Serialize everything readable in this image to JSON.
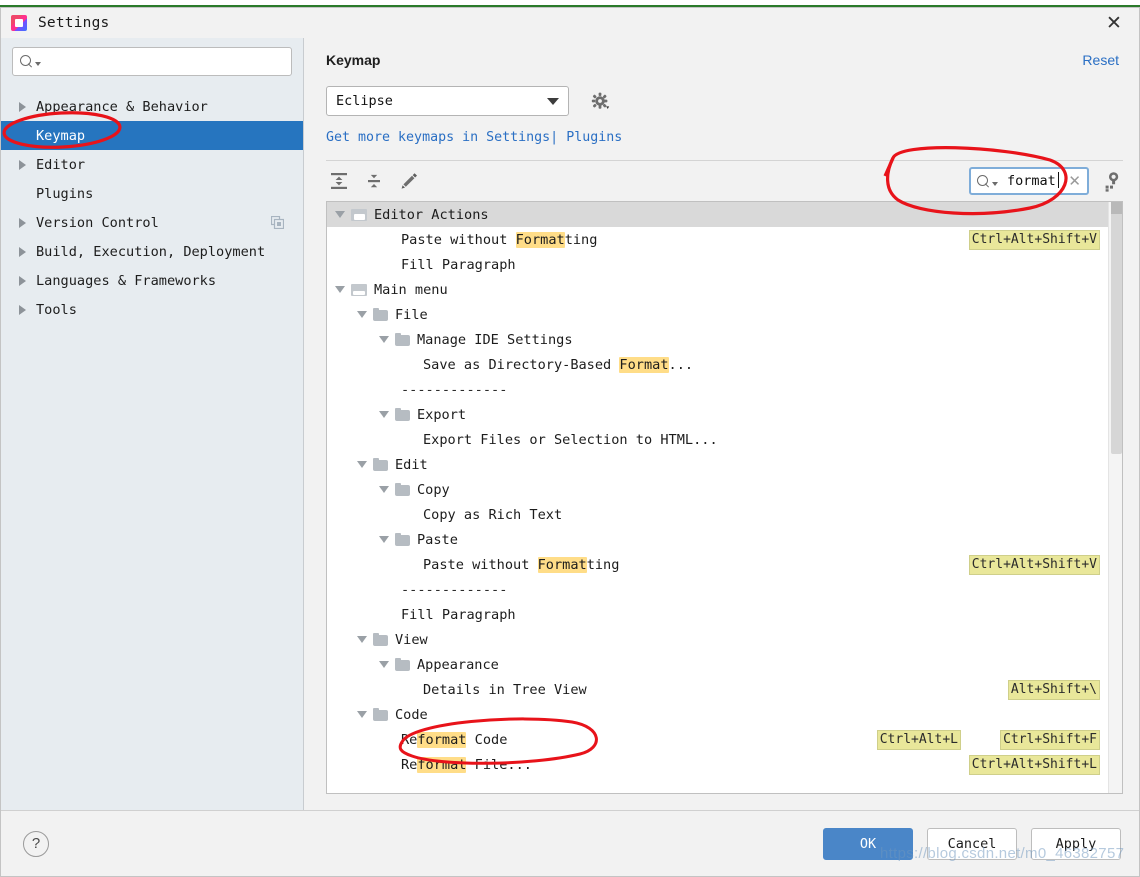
{
  "window": {
    "title": "Settings",
    "app_icon": "intellij-icon",
    "close_label": "✕"
  },
  "sidebar": {
    "search_placeholder": "",
    "search_value": "",
    "items": [
      {
        "label": "Appearance & Behavior",
        "expandable": true,
        "selected": false
      },
      {
        "label": "Keymap",
        "expandable": false,
        "selected": true
      },
      {
        "label": "Editor",
        "expandable": true,
        "selected": false
      },
      {
        "label": "Plugins",
        "expandable": false,
        "selected": false
      },
      {
        "label": "Version Control",
        "expandable": true,
        "selected": false,
        "badge_icon": "copy-icon"
      },
      {
        "label": "Build, Execution, Deployment",
        "expandable": true,
        "selected": false
      },
      {
        "label": "Languages & Frameworks",
        "expandable": true,
        "selected": false
      },
      {
        "label": "Tools",
        "expandable": true,
        "selected": false
      }
    ]
  },
  "content": {
    "title": "Keymap",
    "reset_label": "Reset",
    "keymap_select_value": "Eclipse",
    "gear_icon": "gear-icon",
    "links": {
      "prefix": "Get more keymaps in Settings",
      "separator": "|",
      "plugins": "Plugins"
    },
    "toolbar": {
      "expand_all_icon": "expand-all-icon",
      "collapse_all_icon": "collapse-all-icon",
      "edit_icon": "pencil-edit-icon"
    },
    "search": {
      "value": "format",
      "clear_label": "✕",
      "filter_icon": "filter-by-shortcut-icon"
    }
  },
  "tree": {
    "rows": [
      {
        "indent": 0,
        "twisty": "down",
        "icon": "editor-actions-icon",
        "text": "Editor Actions",
        "highlight": null,
        "shortcut": null,
        "header": true
      },
      {
        "indent": 3,
        "twisty": null,
        "icon": null,
        "text": "Paste without Formatting",
        "highlight": "Format",
        "shortcut": "Ctrl+Alt+Shift+V",
        "header": false
      },
      {
        "indent": 3,
        "twisty": null,
        "icon": null,
        "text": "Fill Paragraph",
        "highlight": null,
        "shortcut": null,
        "header": false
      },
      {
        "indent": 0,
        "twisty": "down",
        "icon": "main-menu-icon",
        "text": "Main menu",
        "highlight": null,
        "shortcut": null,
        "header": false
      },
      {
        "indent": 1,
        "twisty": "down",
        "icon": "folder-icon",
        "text": "File",
        "highlight": null,
        "shortcut": null,
        "header": false
      },
      {
        "indent": 2,
        "twisty": "down",
        "icon": "folder-icon",
        "text": "Manage IDE Settings",
        "highlight": null,
        "shortcut": null,
        "header": false
      },
      {
        "indent": 4,
        "twisty": null,
        "icon": null,
        "text": "Save as Directory-Based Format...",
        "highlight": "Format",
        "shortcut": null,
        "header": false
      },
      {
        "indent": 3,
        "twisty": null,
        "icon": null,
        "text": "-------------",
        "highlight": null,
        "shortcut": null,
        "header": false,
        "separator": true
      },
      {
        "indent": 2,
        "twisty": "down",
        "icon": "folder-icon",
        "text": "Export",
        "highlight": null,
        "shortcut": null,
        "header": false
      },
      {
        "indent": 4,
        "twisty": null,
        "icon": null,
        "text": "Export Files or Selection to HTML...",
        "highlight": null,
        "shortcut": null,
        "header": false
      },
      {
        "indent": 1,
        "twisty": "down",
        "icon": "folder-icon",
        "text": "Edit",
        "highlight": null,
        "shortcut": null,
        "header": false
      },
      {
        "indent": 2,
        "twisty": "down",
        "icon": "folder-icon",
        "text": "Copy",
        "highlight": null,
        "shortcut": null,
        "header": false
      },
      {
        "indent": 4,
        "twisty": null,
        "icon": null,
        "text": "Copy as Rich Text",
        "highlight": null,
        "shortcut": null,
        "header": false
      },
      {
        "indent": 2,
        "twisty": "down",
        "icon": "folder-icon",
        "text": "Paste",
        "highlight": null,
        "shortcut": null,
        "header": false
      },
      {
        "indent": 4,
        "twisty": null,
        "icon": null,
        "text": "Paste without Formatting",
        "highlight": "Format",
        "shortcut": "Ctrl+Alt+Shift+V",
        "header": false
      },
      {
        "indent": 3,
        "twisty": null,
        "icon": null,
        "text": "-------------",
        "highlight": null,
        "shortcut": null,
        "header": false,
        "separator": true
      },
      {
        "indent": 3,
        "twisty": null,
        "icon": null,
        "text": "Fill Paragraph",
        "highlight": null,
        "shortcut": null,
        "header": false
      },
      {
        "indent": 1,
        "twisty": "down",
        "icon": "folder-icon",
        "text": "View",
        "highlight": null,
        "shortcut": null,
        "header": false
      },
      {
        "indent": 2,
        "twisty": "down",
        "icon": "folder-icon",
        "text": "Appearance",
        "highlight": null,
        "shortcut": null,
        "header": false
      },
      {
        "indent": 4,
        "twisty": null,
        "icon": null,
        "text": "Details in Tree View",
        "highlight": null,
        "shortcut": "Alt+Shift+\\",
        "header": false
      },
      {
        "indent": 1,
        "twisty": "down",
        "icon": "folder-icon",
        "text": "Code",
        "highlight": null,
        "shortcut": null,
        "header": false
      },
      {
        "indent": 3,
        "twisty": null,
        "icon": null,
        "text": "Reformat Code",
        "highlight": "format",
        "shortcut": "Ctrl+Alt+L",
        "shortcut2": "Ctrl+Shift+F",
        "header": false
      },
      {
        "indent": 3,
        "twisty": null,
        "icon": null,
        "text": "Reformat File...",
        "highlight": "format",
        "shortcut": "Ctrl+Alt+Shift+L",
        "header": false
      }
    ]
  },
  "footer": {
    "help_label": "?",
    "ok_label": "OK",
    "cancel_label": "Cancel",
    "apply_label": "Apply"
  },
  "watermark": "https://blog.csdn.net/m0_46382757",
  "colors": {
    "selection_blue": "#2675bf",
    "link_blue": "#2a6fc4",
    "highlight_yellow": "#ffdd88",
    "shortcut_bg": "#e9e79a",
    "annotation_red": "#e8131a",
    "primary_button": "#4a86c8"
  }
}
